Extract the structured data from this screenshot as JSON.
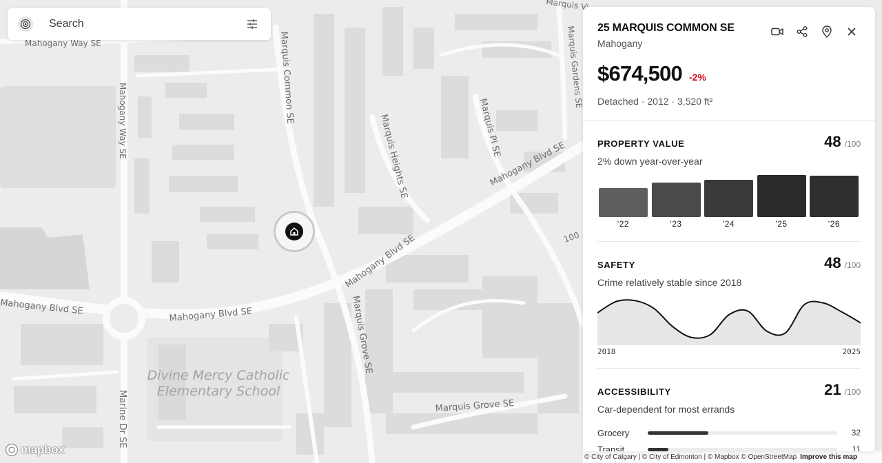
{
  "search": {
    "placeholder": "Search",
    "logo_icon": "target-icon",
    "filter_icon": "sliders-icon"
  },
  "map": {
    "streets": {
      "mahogany_way_top": "Mahogany Way SE",
      "mahogany_way_vertical": "Mahogany Way SE",
      "marquis_common": "Marquis Common SE",
      "marquis_heights": "Marquis Heights SE",
      "marquis_pl": "Marquis Pl SE",
      "marquis_gardens": "Marquis Gardens SE",
      "mahogany_blvd_east": "Mahogany Blvd SE",
      "mahogany_blvd_mid": "Mahogany Blvd SE",
      "mahogany_blvd_south": "Mahogany Blvd SE",
      "mahogany_blvd_west": "Mahogany Blvd SE",
      "marquis_grove_vertical": "Marquis Grove SE",
      "marquis_grove": "Marquis Grove SE",
      "marine_dr": "Marine Dr SE",
      "edge_100": "100",
      "top_edge": "Marquis Vi"
    },
    "school_line1": "Divine Mercy Catholic",
    "school_line2": "Elementary School",
    "pin_icon": "home-icon",
    "mapbox_label": "mapbox",
    "attribution": "© City of Calgary | © City of Edmonton | © Mapbox © OpenStreetMap",
    "improve_link": "Improve this map"
  },
  "property": {
    "address": "25 MARQUIS COMMON SE",
    "neighborhood": "Mahogany",
    "price": "$674,500",
    "price_change": "-2%",
    "details": "Detached · 2012 · 3,520 ft²",
    "actions": [
      "video-icon",
      "share-icon",
      "location-pin-icon",
      "close-icon"
    ]
  },
  "sections": {
    "value": {
      "title": "PROPERTY VALUE",
      "score": "48",
      "score_max": "/100",
      "subtitle": "2% down year-over-year"
    },
    "safety": {
      "title": "SAFETY",
      "score": "48",
      "score_max": "/100",
      "subtitle": "Crime relatively stable since 2018",
      "start_label": "2018",
      "end_label": "2025"
    },
    "access": {
      "title": "ACCESSIBILITY",
      "score": "21",
      "score_max": "/100",
      "subtitle": "Car-dependent for most errands",
      "items": [
        {
          "name": "Grocery",
          "value": "32",
          "fraction": 0.32
        },
        {
          "name": "Transit",
          "value": "11",
          "fraction": 0.11
        }
      ]
    }
  },
  "chart_data": [
    {
      "type": "bar",
      "categories": [
        "'22",
        "'23",
        "'24",
        "'25",
        "'26"
      ],
      "values": [
        41,
        48,
        52,
        59,
        58
      ],
      "colors": [
        "#5e5e5e",
        "#4a4a4a",
        "#3a3a3a",
        "#2b2b2b",
        "#2f2f2f"
      ],
      "title": "",
      "ylim": [
        0,
        60
      ]
    },
    {
      "type": "area",
      "x": [
        2018,
        2018.5,
        2019,
        2019.5,
        2020,
        2020.5,
        2021,
        2021.5,
        2022,
        2022.5,
        2023,
        2023.5,
        2024,
        2024.5,
        2025
      ],
      "values": [
        68,
        93,
        95,
        78,
        38,
        14,
        20,
        64,
        72,
        28,
        24,
        86,
        90,
        70,
        46
      ],
      "xlabel_start": "2018",
      "xlabel_end": "2025",
      "ylim": [
        0,
        100
      ]
    }
  ]
}
